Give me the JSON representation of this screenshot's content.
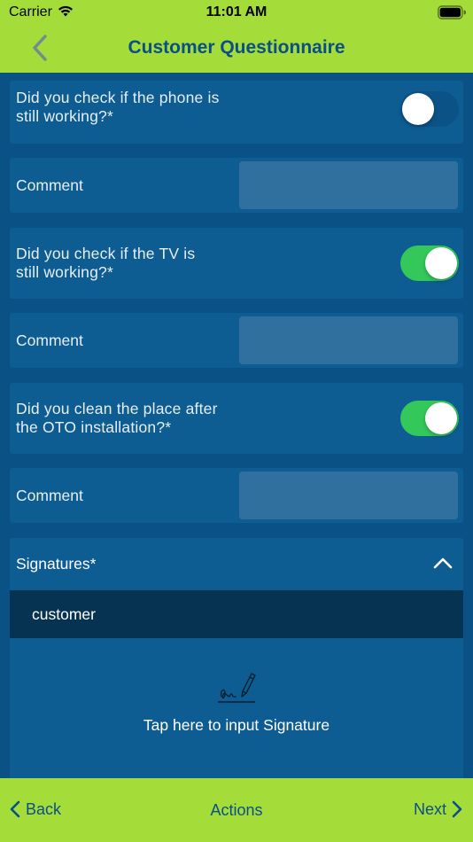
{
  "status_bar": {
    "carrier": "Carrier",
    "time": "11:01 AM"
  },
  "nav": {
    "title": "Customer Questionnaire"
  },
  "questions": [
    {
      "text_line1": "Did you check if the phone is",
      "text_line2": "still working?*",
      "toggle_on": false,
      "comment_label": "Comment",
      "comment_value": ""
    },
    {
      "text_line1": "Did you check if the TV is",
      "text_line2": "still working?*",
      "toggle_on": true,
      "comment_label": "Comment",
      "comment_value": ""
    },
    {
      "text_line1": "Did you clean the place after",
      "text_line2": "the OTO installation?*",
      "toggle_on": true,
      "comment_label": "Comment",
      "comment_value": ""
    }
  ],
  "signatures": {
    "header": "Signatures*",
    "row_label": "customer",
    "tap_text": "Tap here to input Signature"
  },
  "bottom_bar": {
    "back": "Back",
    "actions": "Actions",
    "next": "Next"
  },
  "colors": {
    "accent": "#a4dc3a",
    "brand_blue": "#0b4f86",
    "toggle_on": "#34c759"
  }
}
